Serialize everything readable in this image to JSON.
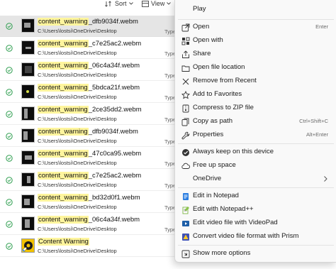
{
  "toolbar": {
    "sort_label": "Sort",
    "view_label": "View"
  },
  "files": [
    {
      "name": "content_warning_dfb9034f.webm",
      "highlight": "content_warning",
      "rest": "_dfb9034f.webm",
      "path": "C:\\Users\\lostsi\\OneDrive\\Desktop",
      "type": "Type"
    },
    {
      "name": "content_warning_c7e25ac2.webm",
      "highlight": "content_warning",
      "rest": "_c7e25ac2.webm",
      "path": "C:\\Users\\lostsi\\OneDrive\\Desktop",
      "type": "Type"
    },
    {
      "name": "content_warning_06c4a34f.webm",
      "highlight": "content_warning",
      "rest": "_06c4a34f.webm",
      "path": "C:\\Users\\lostsi\\OneDrive\\Desktop",
      "type": "Type"
    },
    {
      "name": "content_warning_5bdca21f.webm",
      "highlight": "content_warning",
      "rest": "_5bdca21f.webm",
      "path": "C:\\Users\\lostsi\\OneDrive\\Desktop",
      "type": "Type"
    },
    {
      "name": "content_warning_2ce35dd2.webm",
      "highlight": "content_warning",
      "rest": "_2ce35dd2.webm",
      "path": "C:\\Users\\lostsi\\OneDrive\\Desktop",
      "type": "Type"
    },
    {
      "name": "content_warning_dfb9034f.webm",
      "highlight": "content_warning",
      "rest": "_dfb9034f.webm",
      "path": "C:\\Users\\lostsi\\OneDrive\\Desktop",
      "type": "Type"
    },
    {
      "name": "content_warning_47c0ca95.webm",
      "highlight": "content_warning",
      "rest": "_47c0ca95.webm",
      "path": "C:\\Users\\lostsi\\OneDrive\\Desktop",
      "type": "Type"
    },
    {
      "name": "content_warning_c7e25ac2.webm",
      "highlight": "content_warning",
      "rest": "_c7e25ac2.webm",
      "path": "C:\\Users\\lostsi\\OneDrive\\Desktop",
      "type": "Type"
    },
    {
      "name": "content_warning_bd32d0f1.webm",
      "highlight": "content_warning",
      "rest": "_bd32d0f1.webm",
      "path": "C:\\Users\\lostsi\\OneDrive\\Desktop",
      "type": "Type"
    },
    {
      "name": "content_warning_06c4a34f.webm",
      "highlight": "content_warning",
      "rest": "_06c4a34f.webm",
      "path": "C:\\Users\\lostsi\\OneDrive\\Desktop",
      "type": "Type"
    },
    {
      "name": "Content Warning",
      "highlight": "Content Warning",
      "rest": "",
      "path": "C:\\Users\\lostsi\\OneDrive\\Desktop",
      "type": ""
    }
  ],
  "menu": {
    "play": "Play",
    "open": "Open",
    "open_shortcut": "Enter",
    "open_with": "Open with",
    "share": "Share",
    "open_file_location": "Open file location",
    "remove_from_recent": "Remove from Recent",
    "add_to_favorites": "Add to Favorites",
    "compress_zip": "Compress to ZIP file",
    "copy_as_path": "Copy as path",
    "copy_as_path_shortcut": "Ctrl+Shift+C",
    "properties": "Properties",
    "properties_shortcut": "Alt+Enter",
    "always_keep": "Always keep on this device",
    "free_up_space": "Free up space",
    "onedrive": "OneDrive",
    "edit_notepad": "Edit in Notepad",
    "edit_notepadpp": "Edit with Notepad++",
    "edit_videopad": "Edit video file with VideoPad",
    "convert_prism": "Convert video file format with Prism",
    "show_more": "Show more options"
  },
  "colors": {
    "highlight": "#fff59d",
    "status_green": "#2e9e4f",
    "menu_bg": "#f9f9f9",
    "selected_row": "#e5e5e5",
    "accent_blue": "#1f6fd1"
  }
}
